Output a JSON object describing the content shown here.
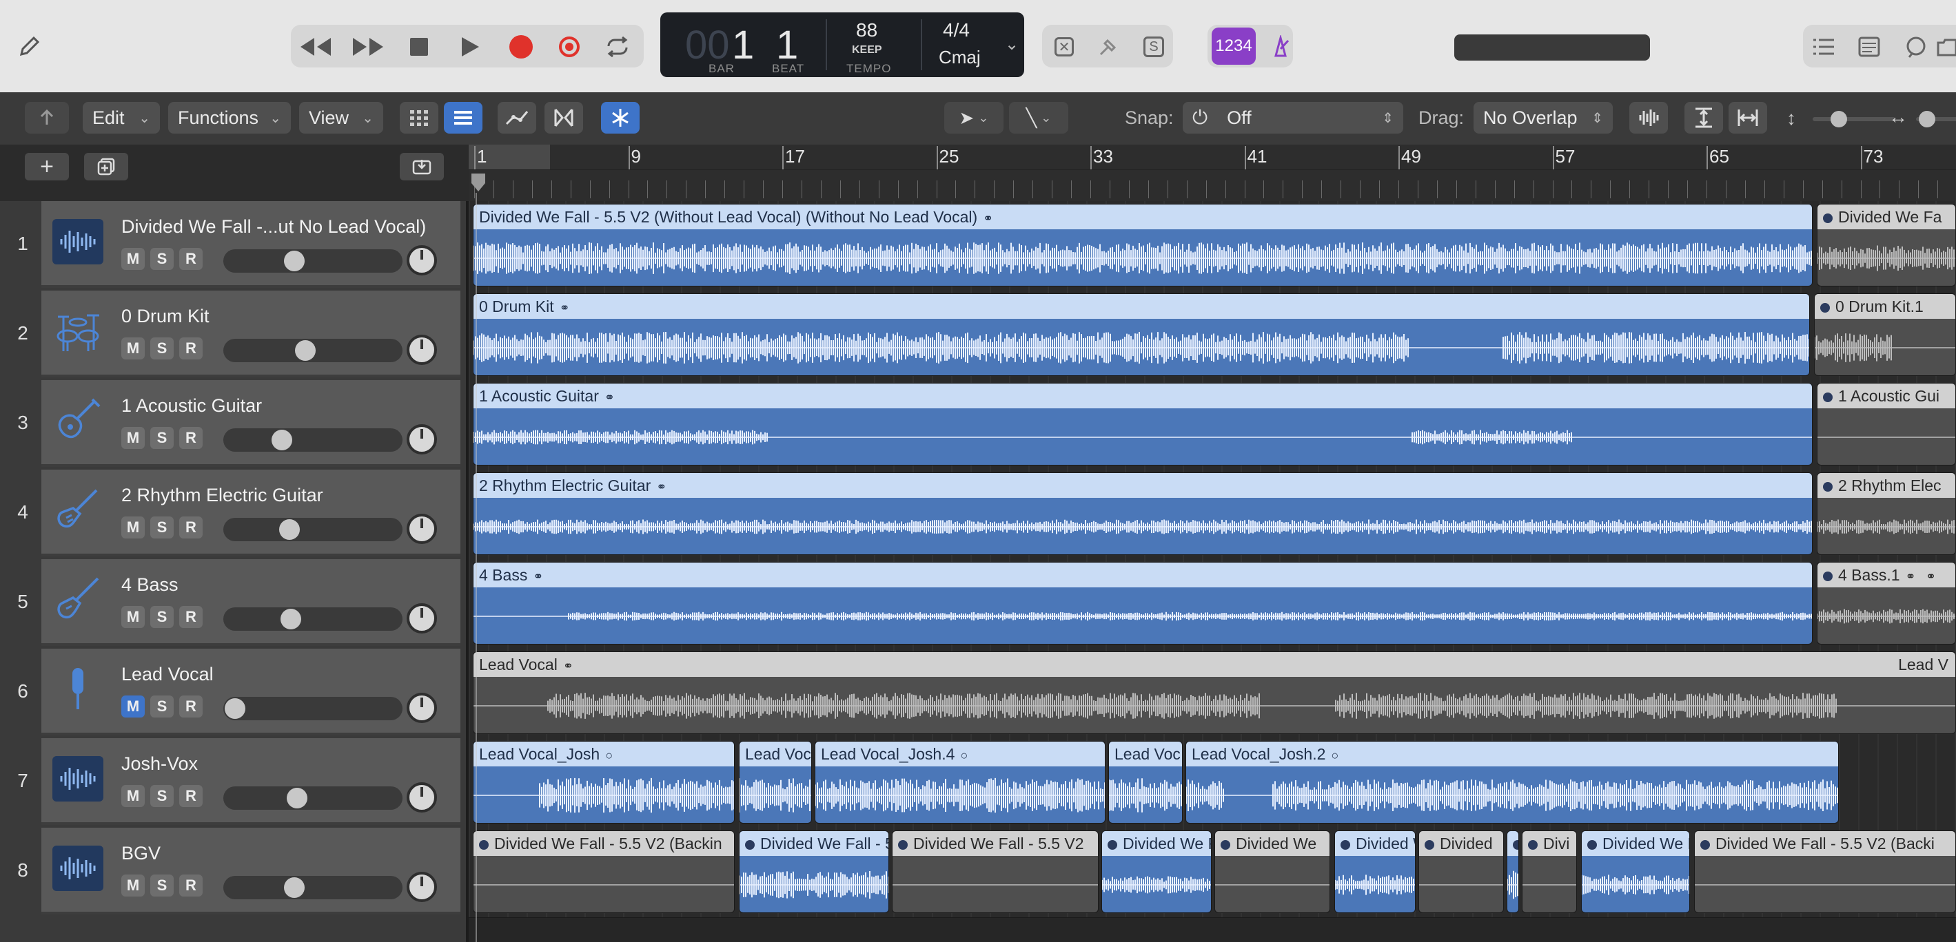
{
  "transport": {
    "bar_dim": "00",
    "bar": "1",
    "beat": "1",
    "bar_label": "BAR",
    "beat_label": "BEAT",
    "tempo": "88",
    "tempo_mode": "KEEP",
    "tempo_label": "TEMPO",
    "signature": "4/4",
    "key": "Cmaj",
    "count_in": "1234"
  },
  "toolbar": {
    "edit": "Edit",
    "functions": "Functions",
    "view": "View",
    "snap_label": "Snap:",
    "snap_value": "Off",
    "drag_label": "Drag:",
    "drag_value": "No Overlap"
  },
  "ruler": {
    "marks": [
      "1",
      "9",
      "17",
      "25",
      "33",
      "41",
      "49",
      "57",
      "65",
      "73"
    ]
  },
  "tracks": [
    {
      "num": "1",
      "name": "Divided We Fall -...ut No Lead Vocal)",
      "icon": "audio-waveform-icon",
      "mute_active": false,
      "volume": 0.38
    },
    {
      "num": "2",
      "name": "0 Drum Kit",
      "icon": "drum-kit-icon",
      "mute_active": false,
      "volume": 0.45
    },
    {
      "num": "3",
      "name": "1 Acoustic Guitar",
      "icon": "acoustic-guitar-icon",
      "mute_active": false,
      "volume": 0.3
    },
    {
      "num": "4",
      "name": "2 Rhythm Electric Guitar",
      "icon": "electric-guitar-icon",
      "mute_active": false,
      "volume": 0.35
    },
    {
      "num": "5",
      "name": "4 Bass",
      "icon": "bass-guitar-icon",
      "mute_active": false,
      "volume": 0.36
    },
    {
      "num": "6",
      "name": "Lead Vocal",
      "icon": "microphone-icon",
      "mute_active": true,
      "volume": 0.0
    },
    {
      "num": "7",
      "name": "Josh-Vox",
      "icon": "audio-waveform-icon",
      "mute_active": false,
      "volume": 0.4
    },
    {
      "num": "8",
      "name": "BGV",
      "icon": "audio-waveform-icon",
      "mute_active": false,
      "volume": 0.38
    }
  ],
  "msr": {
    "m": "M",
    "s": "S",
    "r": "R"
  },
  "regions": {
    "t1": [
      "Divided We Fall - 5.5 V2 (Without Lead Vocal) (Without No Lead Vocal)",
      "Divided We Fa"
    ],
    "t2": [
      "0 Drum Kit",
      "0 Drum Kit.1"
    ],
    "t3": [
      "1 Acoustic Guitar",
      "1 Acoustic Gui"
    ],
    "t4": [
      "2 Rhythm Electric Guitar",
      "2 Rhythm Elec"
    ],
    "t5": [
      "4 Bass",
      "4 Bass.1"
    ],
    "t6": [
      "Lead Vocal",
      "Lead V"
    ],
    "t7": [
      "Lead Vocal_Josh",
      "Lead Voc",
      "Lead Vocal_Josh.4",
      "Lead Voc",
      "Lead Vocal_Josh.2"
    ],
    "t8": [
      "Divided We Fall - 5.5 V2 (Backin",
      "Divided We Fall - 5.",
      "Divided We Fall - 5.5 V2",
      "Divided We Fa",
      "Divided We",
      "Divided W",
      "Divided",
      "",
      "Divi",
      "Divided We Fa",
      "Divided We Fall - 5.5 V2 (Backi"
    ]
  },
  "colors": {
    "region_blue": "#4b77b8",
    "region_header_blue": "#c9dcf5",
    "record_red": "#e0322b",
    "count_in_purple": "#8a3fc7"
  }
}
